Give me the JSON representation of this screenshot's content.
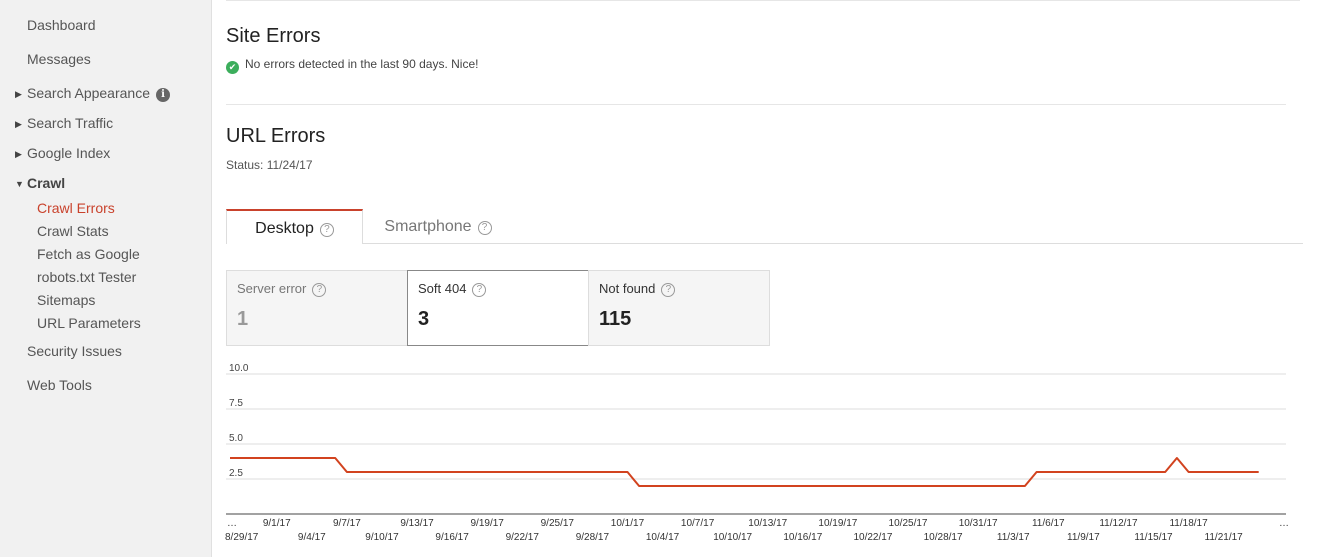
{
  "sidebar": {
    "dashboard": "Dashboard",
    "messages": "Messages",
    "search_appearance": "Search Appearance",
    "search_traffic": "Search Traffic",
    "google_index": "Google Index",
    "crawl": "Crawl",
    "crawl_items": [
      "Crawl Errors",
      "Crawl Stats",
      "Fetch as Google",
      "robots.txt Tester",
      "Sitemaps",
      "URL Parameters"
    ],
    "security_issues": "Security Issues",
    "web_tools": "Web Tools"
  },
  "site_errors": {
    "title": "Site Errors",
    "message": "No errors detected in the last 90 days. Nice!"
  },
  "url_errors": {
    "title": "URL Errors",
    "status": "Status: 11/24/17"
  },
  "tabs": [
    "Desktop",
    "Smartphone"
  ],
  "metrics": [
    {
      "label": "Server error",
      "value": "1"
    },
    {
      "label": "Soft 404",
      "value": "3"
    },
    {
      "label": "Not found",
      "value": "115"
    }
  ],
  "colors": {
    "accent": "#c9422c",
    "line": "#d2431f",
    "ok": "#3cae5c"
  },
  "chart_data": {
    "type": "line",
    "ylim": [
      0,
      10
    ],
    "y_ticks": [
      "2.5",
      "7.5",
      "5.0",
      "10.0"
    ],
    "x_ticks_top": [
      "…",
      "9/1/17",
      "9/7/17",
      "9/13/17",
      "9/19/17",
      "9/25/17",
      "10/1/17",
      "10/7/17",
      "10/13/17",
      "10/19/17",
      "10/25/17",
      "10/31/17",
      "11/6/17",
      "11/12/17",
      "11/18/17",
      "…"
    ],
    "x_ticks_bottom": [
      "8/29/17",
      "9/4/17",
      "9/10/17",
      "9/16/17",
      "9/22/17",
      "9/28/17",
      "10/4/17",
      "10/10/17",
      "10/16/17",
      "10/22/17",
      "10/28/17",
      "11/3/17",
      "11/9/17",
      "11/15/17",
      "11/21/17"
    ],
    "series": [
      {
        "points": [
          [
            "8/28/17",
            4
          ],
          [
            "9/6/17",
            4
          ],
          [
            "9/7/17",
            3
          ],
          [
            "10/1/17",
            3
          ],
          [
            "10/2/17",
            2
          ],
          [
            "11/4/17",
            2
          ],
          [
            "11/5/17",
            3
          ],
          [
            "11/16/17",
            3
          ],
          [
            "11/17/17",
            4
          ],
          [
            "11/18/17",
            3
          ],
          [
            "11/24/17",
            3
          ]
        ]
      }
    ]
  }
}
